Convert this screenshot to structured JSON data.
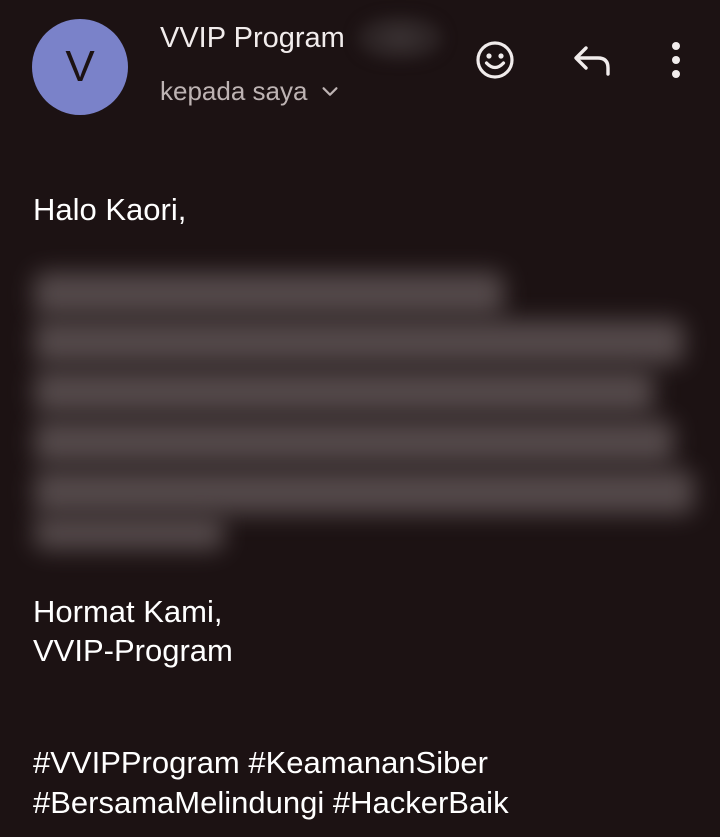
{
  "email": {
    "avatar_letter": "V",
    "avatar_color": "#7a82c9",
    "sender_name": "VVIP Program",
    "recipient_text": "kepada saya",
    "actions": {
      "emoji_icon": "add-reaction-icon",
      "reply_icon": "reply-icon",
      "more_icon": "more-vert-icon"
    },
    "greeting": "Halo Kaori,",
    "body_redacted": true,
    "signoff_line1": "Hormat Kami,",
    "signoff_line2": "VVIP-Program",
    "hashtags_line1": "#VVIPProgram #KeamananSiber",
    "hashtags_line2": "#BersamaMelindungi #HackerBaik"
  },
  "colors": {
    "background": "#1c1213",
    "text": "#ffffff",
    "secondary_text": "#bdb3b3"
  }
}
